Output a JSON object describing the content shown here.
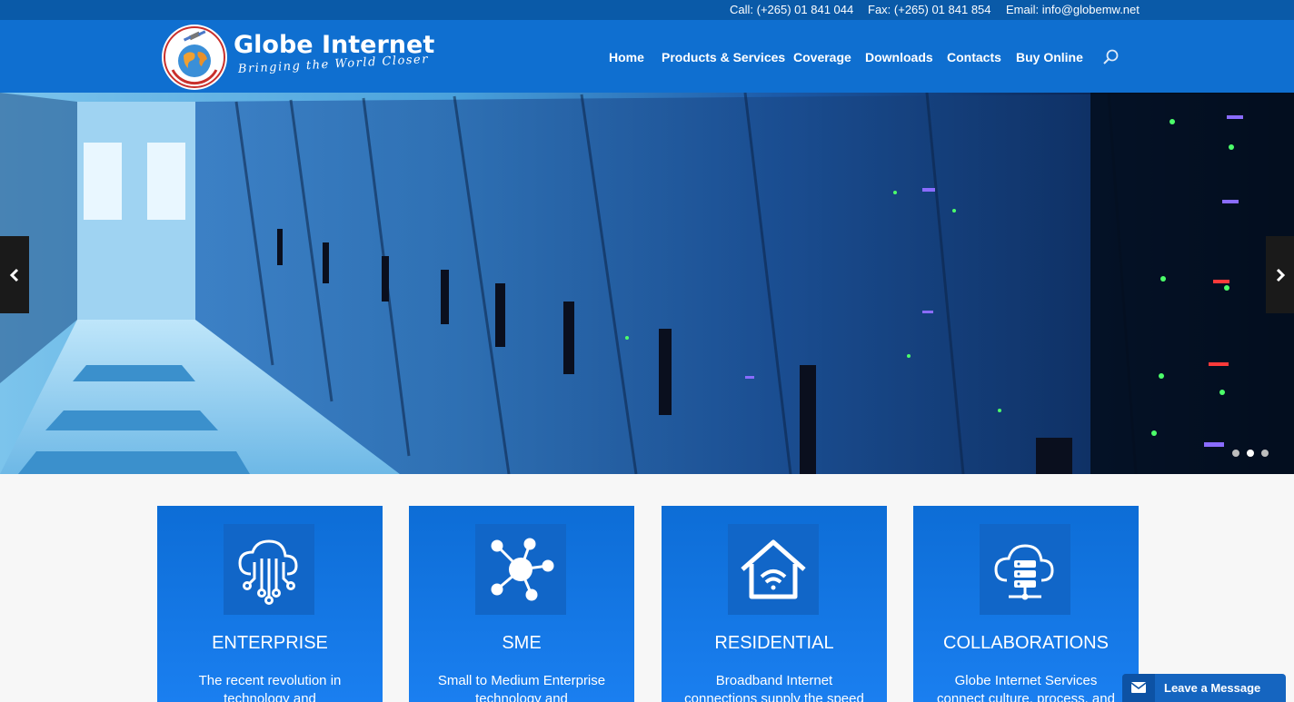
{
  "topbar": {
    "call": "Call: (+265) 01 841 044",
    "fax": "Fax: (+265) 01 841 854",
    "email": "Email: info@globemw.net"
  },
  "logo": {
    "name": "Globe Internet",
    "tagline": "Bringing the World Closer",
    "emblem_text": "GLOBE INTERNET LIMITED",
    "icon": "globe-satellite-icon"
  },
  "nav": {
    "items": [
      "Home",
      "Products & Services",
      "Coverage",
      "Downloads",
      "Contacts",
      "Buy Online"
    ],
    "search_icon": "search-icon"
  },
  "hero": {
    "prev_icon": "chevron-left-icon",
    "next_icon": "chevron-right-icon",
    "slide_count": 3,
    "active_slide": 2
  },
  "cards": [
    {
      "title": "ENTERPRISE",
      "text": "The recent revolution in technology and",
      "icon": "cloud-circuit-icon"
    },
    {
      "title": "SME",
      "text": "Small to Medium Enterprise technology and",
      "icon": "network-hub-icon"
    },
    {
      "title": "RESIDENTIAL",
      "text": "Broadband Internet connections supply the speed",
      "icon": "home-wifi-icon"
    },
    {
      "title": "COLLABORATIONS",
      "text": "Globe Internet Services connect culture, process, and",
      "icon": "cloud-server-icon"
    }
  ],
  "chat": {
    "label": "Leave a Message",
    "icon": "envelope-icon"
  },
  "colors": {
    "topbar": "#0a5aa8",
    "header": "#0f6fd0",
    "card": "#1a7ff0",
    "chat": "#1565c0"
  }
}
